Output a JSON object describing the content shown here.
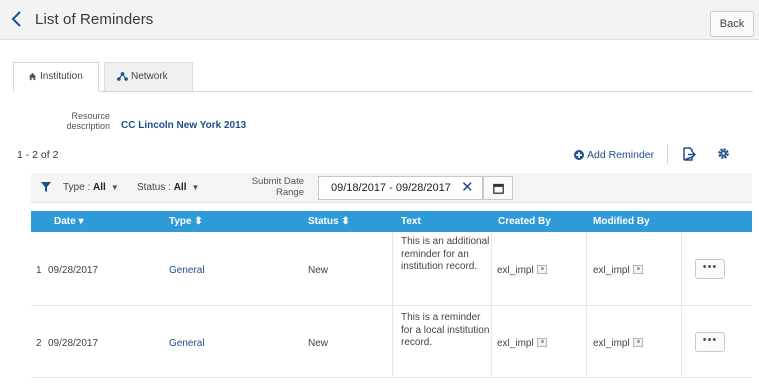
{
  "header": {
    "title": "List of Reminders",
    "back_label": "Back"
  },
  "tabs": [
    {
      "label": "Institution",
      "active": true
    },
    {
      "label": "Network",
      "active": false
    }
  ],
  "resource": {
    "label": "Resource description",
    "value": "CC Lincoln New York 2013"
  },
  "results": {
    "count": "1 - 2 of 2"
  },
  "toolbar": {
    "add_label": "Add Reminder"
  },
  "filters": {
    "type_label": "Type :",
    "type_value": "All",
    "status_label": "Status :",
    "status_value": "All",
    "date_label": "Submit Date Range",
    "date_value": "09/18/2017 - 09/28/2017"
  },
  "table": {
    "columns": [
      "Date",
      "Type",
      "Status",
      "Text",
      "Created By",
      "Modified By"
    ],
    "rows": [
      {
        "num": "1",
        "date": "09/28/2017",
        "type": "General",
        "status": "New",
        "text": "This is an additional reminder for an institution record.",
        "created_by": "exl_impl",
        "modified_by": "exl_impl"
      },
      {
        "num": "2",
        "date": "09/28/2017",
        "type": "General",
        "status": "New",
        "text": "This is a reminder for a local institution record.",
        "created_by": "exl_impl",
        "modified_by": "exl_impl"
      }
    ]
  },
  "colors": {
    "accent": "#2f9ad8",
    "link": "#1f4e8c",
    "header_bg": "#f3f3f3"
  },
  "icons": [
    "chevron-left-icon",
    "home-icon",
    "network-icon",
    "plus-circle-icon",
    "export-icon",
    "gear-icon",
    "filter-icon",
    "calendar-icon",
    "user-icon",
    "more-icon"
  ]
}
